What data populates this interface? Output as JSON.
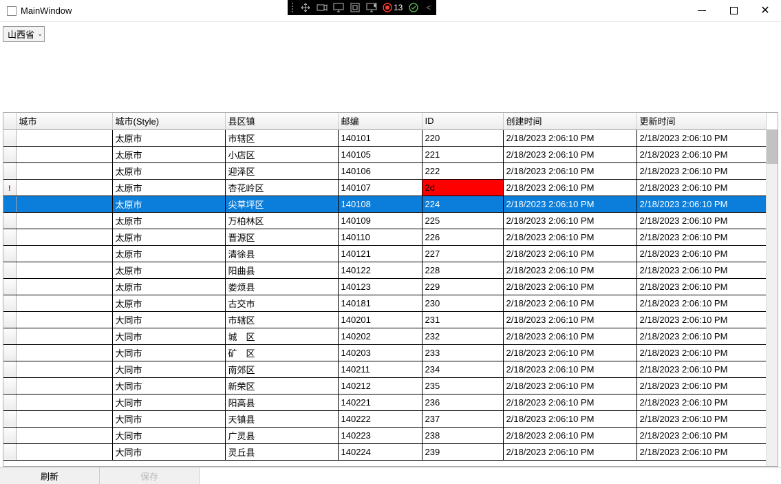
{
  "window": {
    "title": "MainWindow"
  },
  "recorder": {
    "count": "13"
  },
  "province_select": {
    "value": "山西省"
  },
  "columns": {
    "city": "城市",
    "city_style": "城市(Style)",
    "district": "县区镇",
    "postal": "邮编",
    "id": "ID",
    "created": "创建时间",
    "updated": "更新时间"
  },
  "rows": [
    {
      "city": "",
      "city_style": "太原市",
      "district": "市辖区",
      "postal": "140101",
      "id": "220",
      "created": "2/18/2023 2:06:10 PM",
      "updated": "2/18/2023 2:06:10 PM"
    },
    {
      "city": "",
      "city_style": "太原市",
      "district": "小店区",
      "postal": "140105",
      "id": "221",
      "created": "2/18/2023 2:06:10 PM",
      "updated": "2/18/2023 2:06:10 PM"
    },
    {
      "city": "",
      "city_style": "太原市",
      "district": "迎泽区",
      "postal": "140106",
      "id": "222",
      "created": "2/18/2023 2:06:10 PM",
      "updated": "2/18/2023 2:06:10 PM"
    },
    {
      "city": "",
      "city_style": "太原市",
      "district": "杏花岭区",
      "postal": "140107",
      "id": "2d",
      "created": "2/18/2023 2:06:10 PM",
      "updated": "2/18/2023 2:06:10 PM",
      "error": true,
      "row_marker": "!"
    },
    {
      "city": "",
      "city_style": "太原市",
      "district": "尖草坪区",
      "postal": "140108",
      "id": "224",
      "created": "2/18/2023 2:06:10 PM",
      "updated": "2/18/2023 2:06:10 PM",
      "selected": true
    },
    {
      "city": "",
      "city_style": "太原市",
      "district": "万柏林区",
      "postal": "140109",
      "id": "225",
      "created": "2/18/2023 2:06:10 PM",
      "updated": "2/18/2023 2:06:10 PM"
    },
    {
      "city": "",
      "city_style": "太原市",
      "district": "晋源区",
      "postal": "140110",
      "id": "226",
      "created": "2/18/2023 2:06:10 PM",
      "updated": "2/18/2023 2:06:10 PM"
    },
    {
      "city": "",
      "city_style": "太原市",
      "district": "清徐县",
      "postal": "140121",
      "id": "227",
      "created": "2/18/2023 2:06:10 PM",
      "updated": "2/18/2023 2:06:10 PM"
    },
    {
      "city": "",
      "city_style": "太原市",
      "district": "阳曲县",
      "postal": "140122",
      "id": "228",
      "created": "2/18/2023 2:06:10 PM",
      "updated": "2/18/2023 2:06:10 PM"
    },
    {
      "city": "",
      "city_style": "太原市",
      "district": "娄烦县",
      "postal": "140123",
      "id": "229",
      "created": "2/18/2023 2:06:10 PM",
      "updated": "2/18/2023 2:06:10 PM"
    },
    {
      "city": "",
      "city_style": "太原市",
      "district": "古交市",
      "postal": "140181",
      "id": "230",
      "created": "2/18/2023 2:06:10 PM",
      "updated": "2/18/2023 2:06:10 PM"
    },
    {
      "city": "",
      "city_style": "大同市",
      "district": "市辖区",
      "postal": "140201",
      "id": "231",
      "created": "2/18/2023 2:06:10 PM",
      "updated": "2/18/2023 2:06:10 PM"
    },
    {
      "city": "",
      "city_style": "大同市",
      "district": "城　区",
      "postal": "140202",
      "id": "232",
      "created": "2/18/2023 2:06:10 PM",
      "updated": "2/18/2023 2:06:10 PM"
    },
    {
      "city": "",
      "city_style": "大同市",
      "district": "矿　区",
      "postal": "140203",
      "id": "233",
      "created": "2/18/2023 2:06:10 PM",
      "updated": "2/18/2023 2:06:10 PM"
    },
    {
      "city": "",
      "city_style": "大同市",
      "district": "南郊区",
      "postal": "140211",
      "id": "234",
      "created": "2/18/2023 2:06:10 PM",
      "updated": "2/18/2023 2:06:10 PM"
    },
    {
      "city": "",
      "city_style": "大同市",
      "district": "新荣区",
      "postal": "140212",
      "id": "235",
      "created": "2/18/2023 2:06:10 PM",
      "updated": "2/18/2023 2:06:10 PM"
    },
    {
      "city": "",
      "city_style": "大同市",
      "district": "阳高县",
      "postal": "140221",
      "id": "236",
      "created": "2/18/2023 2:06:10 PM",
      "updated": "2/18/2023 2:06:10 PM"
    },
    {
      "city": "",
      "city_style": "大同市",
      "district": "天镇县",
      "postal": "140222",
      "id": "237",
      "created": "2/18/2023 2:06:10 PM",
      "updated": "2/18/2023 2:06:10 PM"
    },
    {
      "city": "",
      "city_style": "大同市",
      "district": "广灵县",
      "postal": "140223",
      "id": "238",
      "created": "2/18/2023 2:06:10 PM",
      "updated": "2/18/2023 2:06:10 PM"
    },
    {
      "city": "",
      "city_style": "大同市",
      "district": "灵丘县",
      "postal": "140224",
      "id": "239",
      "created": "2/18/2023 2:06:10 PM",
      "updated": "2/18/2023 2:06:10 PM"
    }
  ],
  "footer": {
    "refresh": "刷新",
    "save": "保存"
  }
}
